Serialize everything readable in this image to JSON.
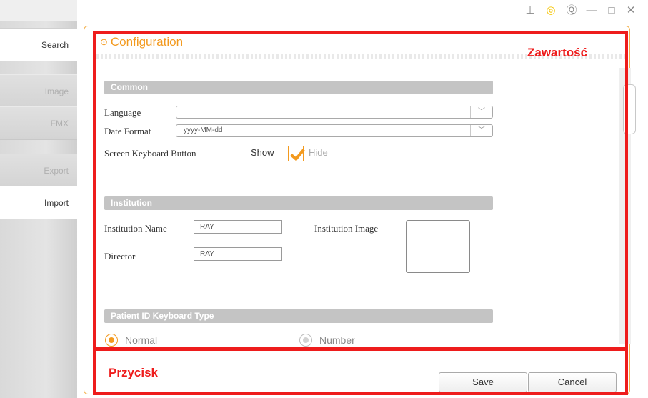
{
  "sidebar": {
    "items": [
      {
        "label": "Search",
        "state": "active"
      },
      {
        "label": "Image",
        "state": "dim"
      },
      {
        "label": "FMX",
        "state": "dim"
      },
      {
        "label": "Export",
        "state": "dim"
      },
      {
        "label": "Import",
        "state": "active"
      }
    ]
  },
  "titlebar": {
    "icons": [
      "pin-icon",
      "settings-icon",
      "help-icon",
      "minimize-icon",
      "maximize-icon",
      "close-icon"
    ],
    "glyphs": {
      "pin": "⊥",
      "settings": "◎",
      "help": "Ⓠ",
      "minimize": "—",
      "maximize": "□",
      "close": "✕"
    }
  },
  "config": {
    "title": "Configuration",
    "title_glyph": "⊙",
    "accent_color": "#f39a1f",
    "common": {
      "header": "Common",
      "language_label": "Language",
      "language_value": "",
      "date_format_label": "Date Format",
      "date_format_value": "yyyy-MM-dd",
      "screen_keyboard_label": "Screen Keyboard Button",
      "show_label": "Show",
      "hide_label": "Hide",
      "show_checked": false,
      "hide_checked": true
    },
    "institution": {
      "header": "Institution",
      "name_label": "Institution Name",
      "name_value": "RAY",
      "director_label": "Director",
      "director_value": "RAY",
      "image_label": "Institution Image"
    },
    "patient_id": {
      "header": "Patient ID Keyboard Type",
      "normal_label": "Normal",
      "number_label": "Number",
      "selected": "Normal"
    }
  },
  "buttons": {
    "save_label": "Save",
    "cancel_label": "Cancel"
  },
  "annotations": {
    "content_label": "Zawartość",
    "button_label": "Przycisk",
    "color": "#ee1c1c"
  },
  "chevron": "﹀"
}
